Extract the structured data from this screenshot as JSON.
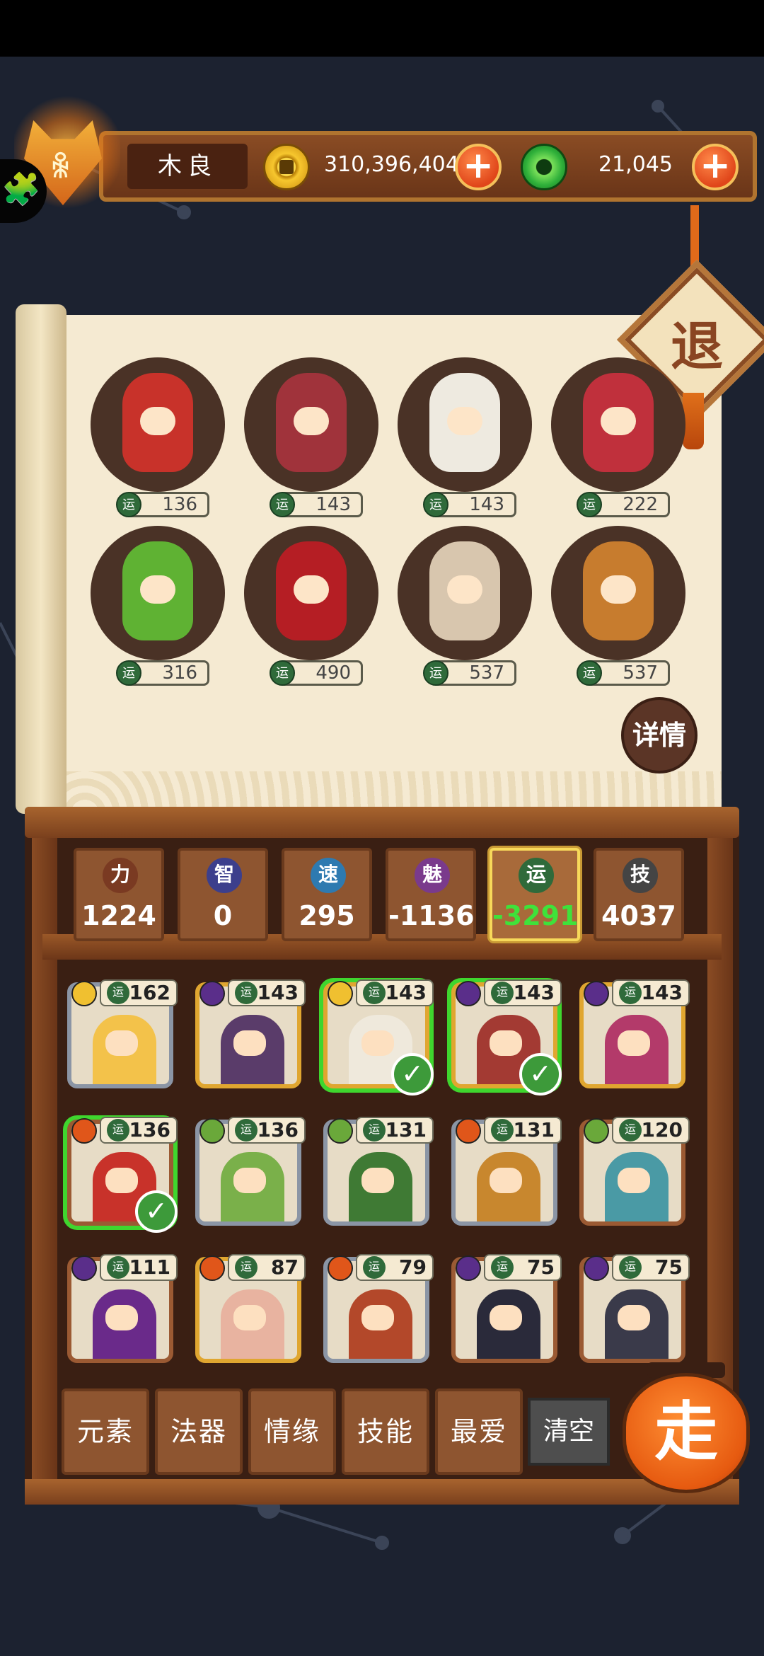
{
  "player": {
    "name": "木良",
    "badge_glyph": "ꆜ"
  },
  "currency": {
    "gold": {
      "amount": "310,396,404",
      "icon": "gold-coin-icon"
    },
    "jade": {
      "amount": "21,045",
      "icon": "jade-coin-icon"
    }
  },
  "icons": {
    "plus": "+",
    "puzzle": "🧩",
    "check": "✓"
  },
  "exit_label": "退",
  "details_label": "详情",
  "luck_glyph": "运",
  "selected_heroes": [
    {
      "luck": "136",
      "color": "#c8322a"
    },
    {
      "luck": "143",
      "color": "#a0333b"
    },
    {
      "luck": "143",
      "color": "#eeeae0"
    },
    {
      "luck": "222",
      "color": "#c0303c"
    },
    {
      "luck": "316",
      "color": "#5fb233"
    },
    {
      "luck": "490",
      "color": "#b51e24"
    },
    {
      "luck": "537",
      "color": "#d8c6ae"
    },
    {
      "luck": "537",
      "color": "#c77c2e"
    }
  ],
  "stats": [
    {
      "glyph": "力",
      "value": "1224",
      "icon_color": "#7a3a22",
      "active": false
    },
    {
      "glyph": "智",
      "value": "0",
      "icon_color": "#3c3f8c",
      "active": false
    },
    {
      "glyph": "速",
      "value": "295",
      "icon_color": "#2e7ab0",
      "active": false
    },
    {
      "glyph": "魅",
      "value": "-1136",
      "icon_color": "#7a3a8c",
      "active": false
    },
    {
      "glyph": "运",
      "value": "-3291",
      "icon_color": "#2f6a3a",
      "active": true
    },
    {
      "glyph": "技",
      "value": "4037",
      "icon_color": "#444444",
      "active": false
    }
  ],
  "roster": [
    {
      "luck": "162",
      "element": "#f0c030",
      "frame": "silver",
      "color": "#f3c24a",
      "selected": false
    },
    {
      "luck": "143",
      "element": "#5a2e8a",
      "frame": "gold",
      "color": "#5a3c6a",
      "selected": false
    },
    {
      "luck": "143",
      "element": "#f0c030",
      "frame": "gold",
      "color": "#efe9dc",
      "selected": true
    },
    {
      "luck": "143",
      "element": "#5a2e8a",
      "frame": "gold",
      "color": "#a33a33",
      "selected": true
    },
    {
      "luck": "143",
      "element": "#5a2e8a",
      "frame": "gold",
      "color": "#b33a6a",
      "selected": false
    },
    {
      "luck": "136",
      "element": "#e0561a",
      "frame": "bronze",
      "color": "#c8322a",
      "selected": true
    },
    {
      "luck": "136",
      "element": "#6aa83a",
      "frame": "silver",
      "color": "#7ab04a",
      "selected": false
    },
    {
      "luck": "131",
      "element": "#6aa83a",
      "frame": "silver",
      "color": "#3f7a34",
      "selected": false
    },
    {
      "luck": "131",
      "element": "#e0561a",
      "frame": "silver",
      "color": "#c8872e",
      "selected": false
    },
    {
      "luck": "120",
      "element": "#6aa83a",
      "frame": "bronze",
      "color": "#4a9aa5",
      "selected": false
    },
    {
      "luck": "111",
      "element": "#5a2e8a",
      "frame": "bronze",
      "color": "#6a2a8a",
      "selected": false
    },
    {
      "luck": "87",
      "element": "#e0561a",
      "frame": "gold",
      "color": "#e8b3a0",
      "selected": false
    },
    {
      "luck": "79",
      "element": "#e0561a",
      "frame": "silver",
      "color": "#b3482a",
      "selected": false
    },
    {
      "luck": "75",
      "element": "#5a2e8a",
      "frame": "bronze",
      "color": "#2a2a3a",
      "selected": false
    },
    {
      "luck": "75",
      "element": "#5a2e8a",
      "frame": "bronze",
      "color": "#3a3a4a",
      "selected": false
    }
  ],
  "filters": [
    {
      "label": "元素"
    },
    {
      "label": "法器"
    },
    {
      "label": "情缘"
    },
    {
      "label": "技能"
    },
    {
      "label": "最爱"
    }
  ],
  "clear_label": "清空",
  "go_label": "走"
}
